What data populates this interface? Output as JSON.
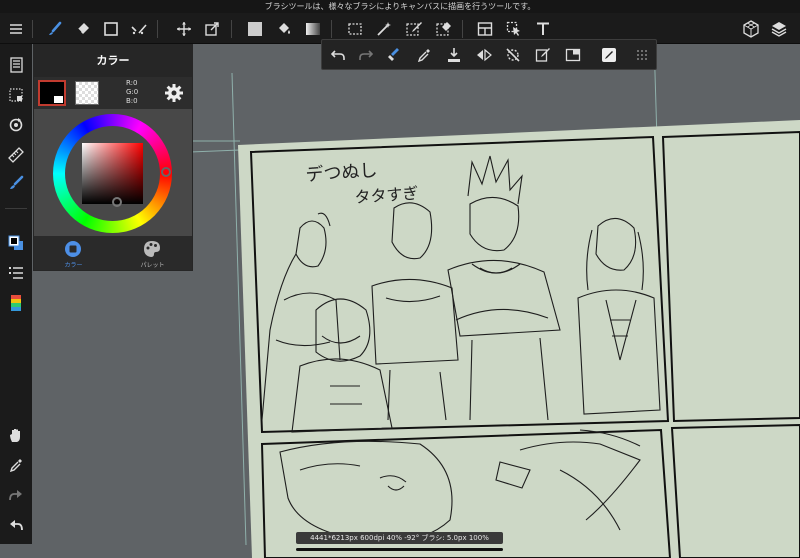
{
  "hint_text": "ブラシツールは、様々なブラシによりキャンバスに描画を行うツールです。",
  "toolbar": {
    "items": [
      "menu-icon",
      "brush-icon",
      "eraser-icon",
      "shape-icon",
      "dots-icon",
      "move-icon",
      "transform-icon",
      "fill-color-icon",
      "bucket-icon",
      "gradient-icon",
      "selection-icon",
      "magic-wand-icon",
      "select-pen-icon",
      "select-eraser-icon",
      "panel-icon",
      "operation-icon",
      "text-icon",
      "3d-icon",
      "layers-icon"
    ]
  },
  "sub_toolbar": {
    "items": [
      "undo-icon",
      "redo-icon",
      "clear-icon",
      "eyedropper-icon",
      "import-icon",
      "flip-icon",
      "no-snap-icon",
      "snap-icon",
      "window-icon",
      "snap-settings-icon",
      "grip-icon"
    ]
  },
  "left_bar": {
    "items": [
      "pages-icon",
      "selection-dotted-icon",
      "transform-rotate-icon",
      "ruler-icon",
      "brush-color-icon",
      "color-swatch-icon",
      "layer-list-icon",
      "palette-strip-icon",
      "hand-icon",
      "eyedropper-icon",
      "redo-icon",
      "undo-icon"
    ]
  },
  "color_panel": {
    "title": "カラー",
    "rgb": {
      "r": "R:0",
      "g": "G:0",
      "b": "B:0"
    },
    "tabs": [
      {
        "label": "カラー",
        "active": true
      },
      {
        "label": "パレット",
        "active": false
      }
    ],
    "main_color": "#000000",
    "sub_color": "#ffffff"
  },
  "canvas": {
    "handwritten_note_line1": "デつぬし",
    "handwritten_note_line2": "タタすぎ",
    "page_color": "#cdd8c6"
  },
  "status": "4441*6213px 600dpi 40% -92° ブラシ: 5.0px 100%"
}
